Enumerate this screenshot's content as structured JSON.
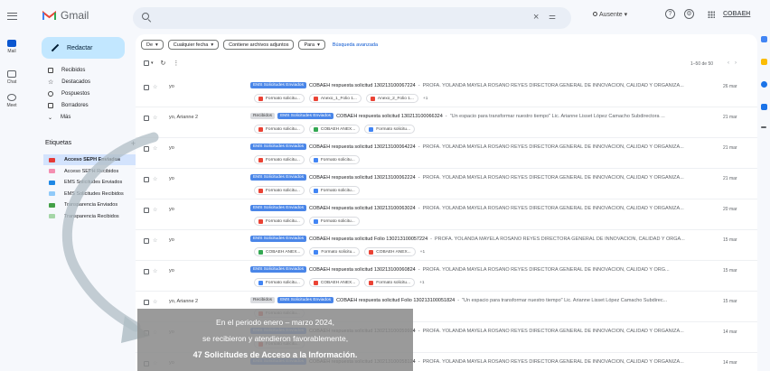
{
  "app": {
    "name": "Gmail",
    "compose_label": "Redactar",
    "status_label": "Ausente",
    "org_label": "COBAEH"
  },
  "left_rail": [
    {
      "label": "Mail",
      "icon": "mail-icon"
    },
    {
      "label": "Chat",
      "icon": "chat-icon"
    },
    {
      "label": "Meet",
      "icon": "meet-icon"
    }
  ],
  "search": {
    "placeholder": ""
  },
  "nav": [
    {
      "label": "Recibidos",
      "icon": "inbox-icon"
    },
    {
      "label": "Destacados",
      "icon": "star-icon"
    },
    {
      "label": "Pospuestos",
      "icon": "clock-icon"
    },
    {
      "label": "Borradores",
      "icon": "draft-icon"
    },
    {
      "label": "Más",
      "icon": "chevron-down-icon"
    }
  ],
  "labels_title": "Etiquetas",
  "labels": [
    {
      "name": "Acceso SEPH Enviados",
      "color": "#e53935",
      "active": true
    },
    {
      "name": "Acceso SEPH Recibidos",
      "color": "#f48fb1",
      "active": false
    },
    {
      "name": "EMS Solicitudes Enviados",
      "color": "#1e88e5",
      "active": false
    },
    {
      "name": "EMS Solicitudes Recibidos",
      "color": "#90caf9",
      "active": false
    },
    {
      "name": "Transparencia Enviados",
      "color": "#43a047",
      "active": false
    },
    {
      "name": "Transparencia Recibidos",
      "color": "#a5d6a7",
      "active": false
    }
  ],
  "filters": {
    "from": "De",
    "date": "Cualquier fecha",
    "attachments": "Contiene archivos adjuntos",
    "to": "Para",
    "advanced": "Búsqueda avanzada"
  },
  "pager": "1–50 de 50",
  "emails": [
    {
      "sender": "yo",
      "tags": [
        "EMS Solicitudes Enviados"
      ],
      "subject": "COBAEH respuesta solicitud 130213100067224",
      "snippet": "PROFA. YOLANDA MAYELA ROSANO REYES DIRECTORA GENERAL DE INNOVACIÓN, CALIDAD Y ORGANIZA...",
      "date": "26 mar",
      "attachments": [
        {
          "name": "Formato solicitu...",
          "color": "#ea4335"
        },
        {
          "name": "Anexo_1_Folio 1...",
          "color": "#ea4335"
        },
        {
          "name": "Anexo_2_Folio 1...",
          "color": "#ea4335"
        }
      ],
      "more": "+1"
    },
    {
      "sender": "yo, Arianne 2",
      "tags": [
        "Recibidos",
        "EMS Solicitudes Enviados"
      ],
      "subject": "COBAEH respuesta solicitud 130213100066324",
      "snippet": "\"Un espacio para transformar nuestro tiempo\" Lic. Arianne Lisset López Camacho Subdirectora ...",
      "date": "21 mar",
      "attachments": [
        {
          "name": "Formato solicitu...",
          "color": "#ea4335"
        },
        {
          "name": "COBAEH ANEX...",
          "color": "#34a853"
        },
        {
          "name": "Formato solicitu...",
          "color": "#4285f4"
        }
      ],
      "more": ""
    },
    {
      "sender": "yo",
      "tags": [
        "EMS Solicitudes Enviados"
      ],
      "subject": "COBAEH respuesta solicitud 130213100064224",
      "snippet": "PROFA. YOLANDA MAYELA ROSANO REYES DIRECTORA GENERAL DE INNOVACIÓN, CALIDAD Y ORGANIZA...",
      "date": "21 mar",
      "attachments": [
        {
          "name": "Formato solicitu...",
          "color": "#ea4335"
        },
        {
          "name": "Formato solicitu...",
          "color": "#4285f4"
        }
      ],
      "more": ""
    },
    {
      "sender": "yo",
      "tags": [
        "EMS Solicitudes Enviados"
      ],
      "subject": "COBAEH respuesta solicitud 130213100062224",
      "snippet": "PROFA. YOLANDA MAYELA ROSANO REYES DIRECTORA GENERAL DE INNOVACIÓN, CALIDAD Y ORGANIZA...",
      "date": "21 mar",
      "attachments": [
        {
          "name": "Formato solicitu...",
          "color": "#ea4335"
        },
        {
          "name": "Formato solicitu...",
          "color": "#4285f4"
        }
      ],
      "more": ""
    },
    {
      "sender": "yo",
      "tags": [
        "EMS Solicitudes Enviados"
      ],
      "subject": "COBAEH respuesta solicitud 130213100063024",
      "snippet": "PROFA. YOLANDA MAYELA ROSANO REYES DIRECTORA GENERAL DE INNOVACIÓN, CALIDAD Y ORGANIZA...",
      "date": "20 mar",
      "attachments": [
        {
          "name": "Formato solicitu...",
          "color": "#ea4335"
        },
        {
          "name": "Formato solicitu...",
          "color": "#4285f4"
        }
      ],
      "more": ""
    },
    {
      "sender": "yo",
      "tags": [
        "EMS Solicitudes Enviados"
      ],
      "subject": "COBAEH respuesta solicitud Folio 130213100057224",
      "snippet": "PROFA. YOLANDA MAYELA ROSANO REYES DIRECTORA GENERAL DE INNOVACIÓN, CALIDAD Y ORGA...",
      "date": "15 mar",
      "attachments": [
        {
          "name": "COBAEH ANEX...",
          "color": "#34a853"
        },
        {
          "name": "Formato solicitu...",
          "color": "#4285f4"
        },
        {
          "name": "COBAEH ANEX...",
          "color": "#ea4335"
        }
      ],
      "more": "+1"
    },
    {
      "sender": "yo",
      "tags": [
        "EMS Solicitudes Enviados"
      ],
      "subject": "COBAEH respuesta solicitud 130213100060824",
      "snippet": "PROFA. YOLANDA MAYELA ROSANO REYES DIRECTORA GENERAL DE INNOVACIÓN, CALIDAD Y ORG...",
      "date": "15 mar",
      "attachments": [
        {
          "name": "Formato solicitu...",
          "color": "#4285f4"
        },
        {
          "name": "COBAEH ANEX...",
          "color": "#ea4335"
        },
        {
          "name": "Formato solicitu...",
          "color": "#ea4335"
        }
      ],
      "more": "+1"
    },
    {
      "sender": "yo, Arianne 2",
      "tags": [
        "Recibidos",
        "EMS Solicitudes Enviados"
      ],
      "subject": "COBAEH respuesta solicitud Folio 130213100051824",
      "snippet": "\"Un espacio para transformar nuestro tiempo\" Lic. Arianne Lisset López Camacho Subdirec...",
      "date": "15 mar",
      "attachments": [
        {
          "name": "Formato solicitu...",
          "color": "#ea4335"
        }
      ],
      "more": ""
    },
    {
      "sender": "yo",
      "tags": [
        "EMS Solicitudes Enviados"
      ],
      "subject": "COBAEH respuesta solicitud 130213100059924",
      "snippet": "PROFA. YOLANDA MAYELA ROSANO REYES DIRECTORA GENERAL DE INNOVACIÓN, CALIDAD Y ORGANIZA...",
      "date": "14 mar",
      "attachments": [
        {
          "name": "Formato solicitu...",
          "color": "#ea4335"
        }
      ],
      "more": ""
    },
    {
      "sender": "yo",
      "tags": [
        "EMS Solicitudes Enviados"
      ],
      "subject": "COBAEH respuesta solicitud 130213100058124",
      "snippet": "PROFA. YOLANDA MAYELA ROSANO REYES DIRECTORA GENERAL DE INNOVACIÓN, CALIDAD Y ORGANIZA...",
      "date": "14 mar",
      "attachments": [],
      "more": ""
    }
  ],
  "callout": {
    "line1": "En el periodo enero – marzo 2024,",
    "line2": "se recibieron y atendieron favorablemente,",
    "line3": "47 Solicitudes de Acceso  a la Información."
  }
}
